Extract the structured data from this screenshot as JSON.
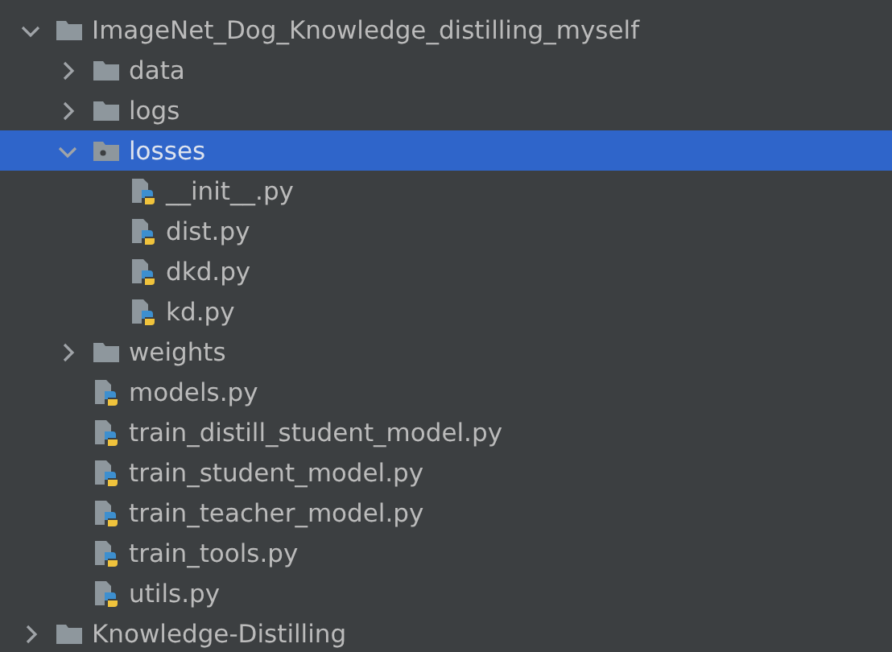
{
  "project_tree": [
    {
      "label": "ImageNet_Dog_Knowledge_distilling_myself",
      "kind": "folder",
      "expanded": true,
      "selected": false,
      "children": [
        {
          "label": "data",
          "kind": "folder",
          "expanded": false,
          "selected": false
        },
        {
          "label": "logs",
          "kind": "folder",
          "expanded": false,
          "selected": false
        },
        {
          "label": "losses",
          "kind": "package",
          "expanded": true,
          "selected": true,
          "children": [
            {
              "label": "__init__.py",
              "kind": "python_file",
              "selected": false
            },
            {
              "label": "dist.py",
              "kind": "python_file",
              "selected": false
            },
            {
              "label": "dkd.py",
              "kind": "python_file",
              "selected": false
            },
            {
              "label": "kd.py",
              "kind": "python_file",
              "selected": false
            }
          ]
        },
        {
          "label": "weights",
          "kind": "folder",
          "expanded": false,
          "selected": false
        },
        {
          "label": "models.py",
          "kind": "python_file",
          "selected": false
        },
        {
          "label": "train_distill_student_model.py",
          "kind": "python_file",
          "selected": false
        },
        {
          "label": "train_student_model.py",
          "kind": "python_file",
          "selected": false
        },
        {
          "label": "train_teacher_model.py",
          "kind": "python_file",
          "selected": false
        },
        {
          "label": "train_tools.py",
          "kind": "python_file",
          "selected": false
        },
        {
          "label": "utils.py",
          "kind": "python_file",
          "selected": false
        }
      ]
    },
    {
      "label": "Knowledge-Distilling",
      "kind": "folder",
      "expanded": false,
      "selected": false
    }
  ]
}
